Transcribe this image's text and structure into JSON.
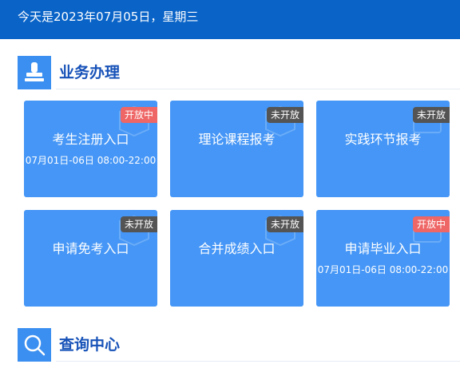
{
  "header": {
    "date_text": "今天是2023年07月05日，星期三"
  },
  "business": {
    "title": "业务办理",
    "icon": "stamp-icon",
    "tiles": [
      {
        "label": "考生注册入口",
        "status": "开放中",
        "time": "07月01日-06日 08:00-22:00"
      },
      {
        "label": "理论课程报考",
        "status": "未开放",
        "time": ""
      },
      {
        "label": "实践环节报考",
        "status": "未开放",
        "time": ""
      },
      {
        "label": "申请免考入口",
        "status": "未开放",
        "time": ""
      },
      {
        "label": "合并成绩入口",
        "status": "未开放",
        "time": ""
      },
      {
        "label": "申请毕业入口",
        "status": "开放中",
        "time": "07月01日-06日 08:00-22:00"
      }
    ]
  },
  "query": {
    "title": "查询中心",
    "icon": "search-icon"
  },
  "colors": {
    "header_bg": "#0a64c8",
    "tile_bg": "#4596f6",
    "badge_open": "#ef6666",
    "badge_closed": "#545454",
    "section_title": "#1752b8"
  }
}
